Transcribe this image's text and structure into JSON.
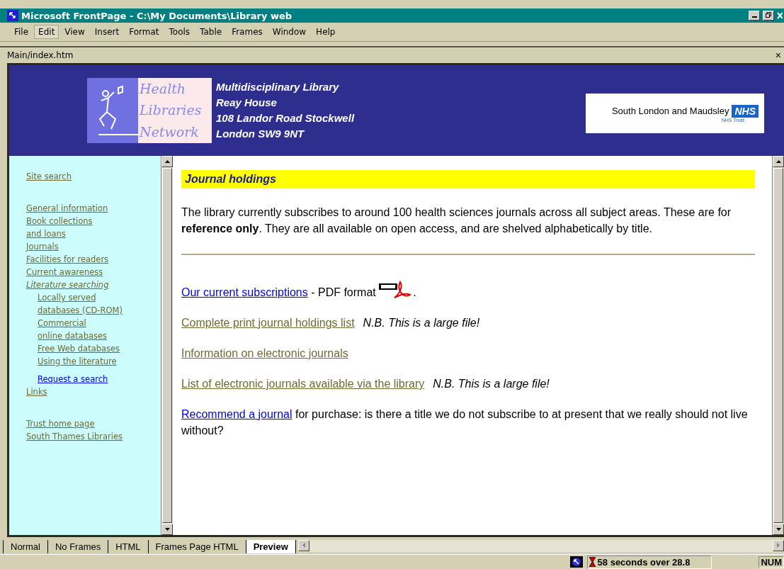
{
  "window": {
    "title": "Microsoft FrontPage - C:\\My Documents\\Library web"
  },
  "menu": [
    {
      "label": "File",
      "selected": false
    },
    {
      "label": "Edit",
      "selected": true
    },
    {
      "label": "View",
      "selected": false
    },
    {
      "label": "Insert",
      "selected": false
    },
    {
      "label": "Format",
      "selected": false
    },
    {
      "label": "Tools",
      "selected": false
    },
    {
      "label": "Table",
      "selected": false
    },
    {
      "label": "Frames",
      "selected": false
    },
    {
      "label": "Window",
      "selected": false
    },
    {
      "label": "Help",
      "selected": false
    }
  ],
  "document": {
    "title": "Main/index.htm",
    "close": "×"
  },
  "banner": {
    "logo_lines": [
      "Health",
      "Libraries",
      "Network"
    ],
    "address": [
      "Multidisciplinary Library",
      "Reay House",
      "108 Landor Road Stockwell",
      "London SW9 9NT"
    ],
    "trust_name": "South London and Maudsley",
    "trust_badge": "NHS",
    "trust_sub": "NHS Trust"
  },
  "sidebar": {
    "groups": [
      [
        {
          "label": "Site search",
          "visited": true,
          "current": false
        }
      ],
      [
        {
          "label": "General information",
          "visited": true,
          "current": false
        },
        {
          "label": "Book collections",
          "visited": true,
          "current": false
        },
        {
          "label": "and loans",
          "visited": true,
          "current": false
        },
        {
          "label": "Journals",
          "visited": true,
          "current": false
        },
        {
          "label": "Facilities for readers",
          "visited": true,
          "current": false
        },
        {
          "label": "Current awareness",
          "visited": true,
          "current": false
        },
        {
          "label": "Literature searching",
          "visited": true,
          "current": true,
          "children": [
            {
              "label": "Locally served",
              "visited": true,
              "current": false
            },
            {
              "label": "databases (CD-ROM)",
              "visited": true,
              "current": false
            },
            {
              "label": "Commercial",
              "visited": true,
              "current": false
            },
            {
              "label": "online databases",
              "visited": true,
              "current": false
            },
            {
              "label": "Free Web databases",
              "visited": true,
              "current": false
            },
            {
              "label": "Using the literature",
              "visited": true,
              "current": false
            },
            {
              "label": "Request a search",
              "visited": false,
              "current": false,
              "gap": true
            }
          ]
        },
        {
          "label": "Links",
          "visited": true,
          "current": false
        }
      ],
      [
        {
          "label": "Trust home page",
          "visited": true,
          "current": false
        },
        {
          "label": "South Thames Libraries",
          "visited": true,
          "current": false
        }
      ]
    ]
  },
  "main": {
    "heading": "Journal holdings",
    "intro": "The library currently subscribes to around 100 health sciences journals across all subject areas. These are for **reference only**. They are all available on open access, and are shelved alphabetically by title.",
    "items": [
      {
        "link": "Our current subscriptions",
        "visited": false,
        "text": " - PDF format ",
        "pdf_icon": true,
        "after": "."
      },
      {
        "link": "Complete print journal holdings list",
        "visited": true,
        "note": "N.B. This is a large file!"
      },
      {
        "link": "Information on electronic journals",
        "visited": true
      },
      {
        "link": "List of electronic journals available via the library",
        "visited": true,
        "note": "N.B. This is a large file!"
      },
      {
        "link": "Recommend a journal",
        "visited": false,
        "text": " for purchase: is there a title we do not subscribe to at present that we really should not live without?"
      }
    ]
  },
  "view_tabs": [
    {
      "label": "Normal",
      "selected": false
    },
    {
      "label": "No Frames",
      "selected": false
    },
    {
      "label": "HTML",
      "selected": false
    },
    {
      "label": "Frames Page HTML",
      "selected": false
    },
    {
      "label": "Preview",
      "selected": true
    }
  ],
  "status_bar": {
    "timing": "58 seconds over 28.8",
    "num": "NUM"
  }
}
